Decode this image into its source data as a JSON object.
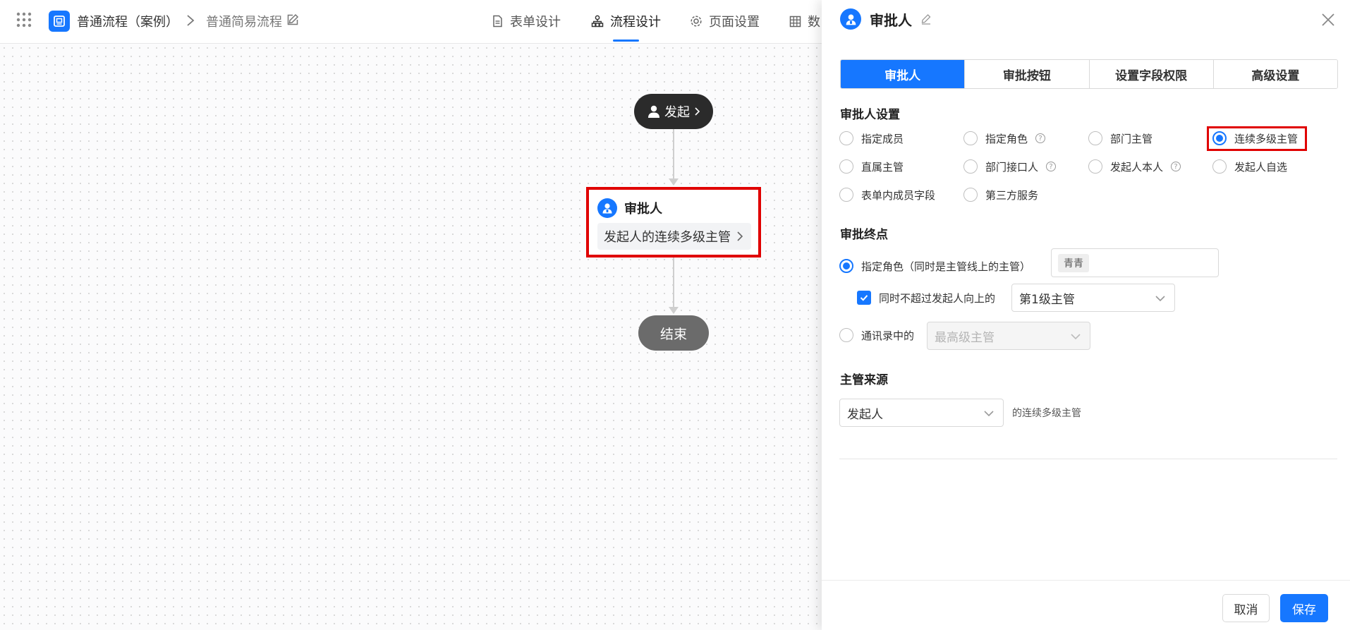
{
  "topbar": {
    "app_title": "普通流程（案例）",
    "crumb_sub": "普通简易流程",
    "tabs": [
      {
        "label": "表单设计"
      },
      {
        "label": "流程设计"
      },
      {
        "label": "页面设置"
      },
      {
        "label": "数"
      }
    ],
    "active_tab": "流程设计"
  },
  "canvas": {
    "start_label": "发起",
    "approver_title": "审批人",
    "approver_desc": "发起人的连续多级主管",
    "end_label": "结束"
  },
  "drawer": {
    "title": "审批人",
    "tabs": [
      "审批人",
      "审批按钮",
      "设置字段权限",
      "高级设置"
    ],
    "approver_settings": {
      "title": "审批人设置",
      "options": [
        "指定成员",
        "指定角色",
        "部门主管",
        "连续多级主管",
        "直属主管",
        "部门接口人",
        "发起人本人",
        "发起人自选",
        "表单内成员字段",
        "第三方服务"
      ],
      "selected": "连续多级主管"
    },
    "endpoint": {
      "title": "审批终点",
      "role_option": "指定角色（同时是主管线上的主管）",
      "role_tag": "青青",
      "limit_label": "同时不超过发起人向上的",
      "limit_value": "第1级主管",
      "contacts_option": "通讯录中的",
      "contacts_value": "最高级主管"
    },
    "source": {
      "title": "主管来源",
      "value": "发起人",
      "suffix": "的连续多级主管"
    },
    "cancel_label": "取消",
    "save_label": "保存"
  },
  "colors": {
    "accent": "#1677ff",
    "highlight": "#e00000"
  }
}
